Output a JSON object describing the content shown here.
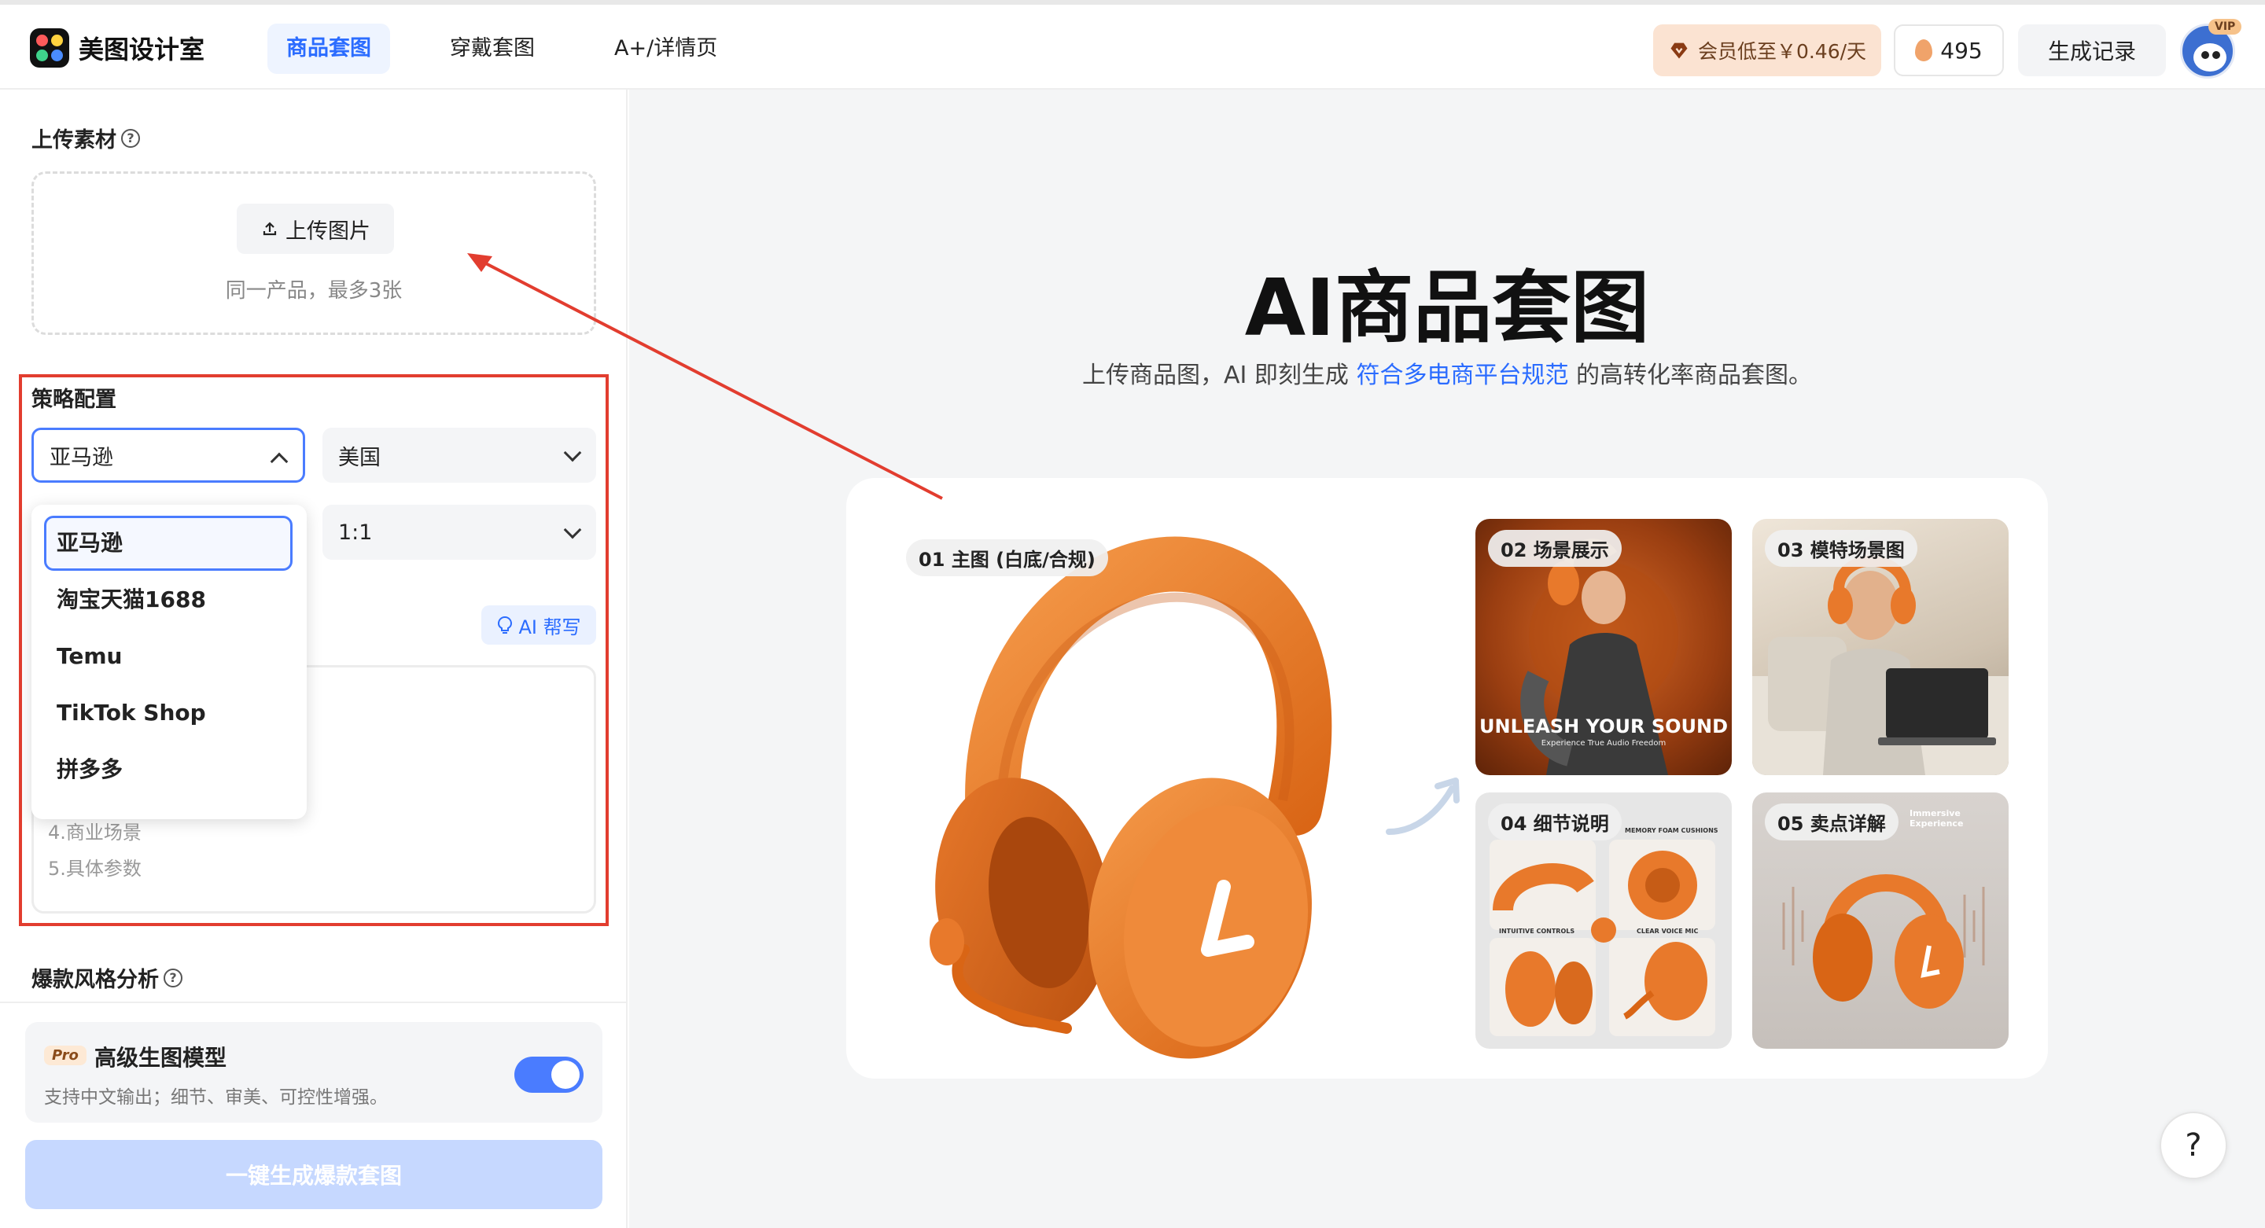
{
  "app": {
    "name": "美图设计室"
  },
  "nav": {
    "tabs": [
      {
        "label": "商品套图"
      },
      {
        "label": "穿戴套图"
      },
      {
        "label": "A+/详情页"
      }
    ]
  },
  "header": {
    "vip_label": "会员低至￥0.46/天",
    "credits": "495",
    "history_label": "生成记录",
    "vip_badge": "VIP"
  },
  "upload": {
    "title": "上传素材",
    "button_label": "上传图片",
    "hint": "同一产品，最多3张"
  },
  "strategy": {
    "title": "策略配置",
    "platform_selected": "亚马逊",
    "region_selected": "美国",
    "ratio_selected": "1:1",
    "ai_help_label": "AI 帮写",
    "platform_options": [
      "亚马逊",
      "淘宝天猫1688",
      "Temu",
      "TikTok Shop",
      "拼多多"
    ],
    "textarea_visible_lines": [
      "4.商业场景",
      "5.具体参数"
    ]
  },
  "style_analysis": {
    "title": "爆款风格分析"
  },
  "pro_model": {
    "tag": "Pro",
    "title": "高级生图模型",
    "desc": "支持中文输出；细节、审美、可控性增强。",
    "enabled": true
  },
  "generate_button": "一键生成爆款套图",
  "hero": {
    "title": "AI商品套图",
    "subtitle_before": "上传商品图，AI 即刻生成 ",
    "subtitle_highlight": "符合多电商平台规范",
    "subtitle_after": " 的高转化率商品套图。"
  },
  "showcase": {
    "main_tag": "01 主图 (白底/合规)",
    "thumbs": [
      {
        "tag": "02 场景展示",
        "caption": "UNLEASH YOUR SOUND",
        "subcaption": "Experience True Audio Freedom"
      },
      {
        "tag": "03 模特场景图"
      },
      {
        "tag": "04 细节说明",
        "labels": [
          "MEMORY FOAM CUSHIONS",
          "INTUITIVE CONTROLS",
          "CLEAR VOICE MIC"
        ]
      },
      {
        "tag": "05 卖点详解",
        "label": "Immersive Experience"
      }
    ]
  },
  "help": "?",
  "colors": {
    "accent": "#2b6cff",
    "annotation_red": "#e23d2f",
    "product_orange": "#e8792b"
  }
}
